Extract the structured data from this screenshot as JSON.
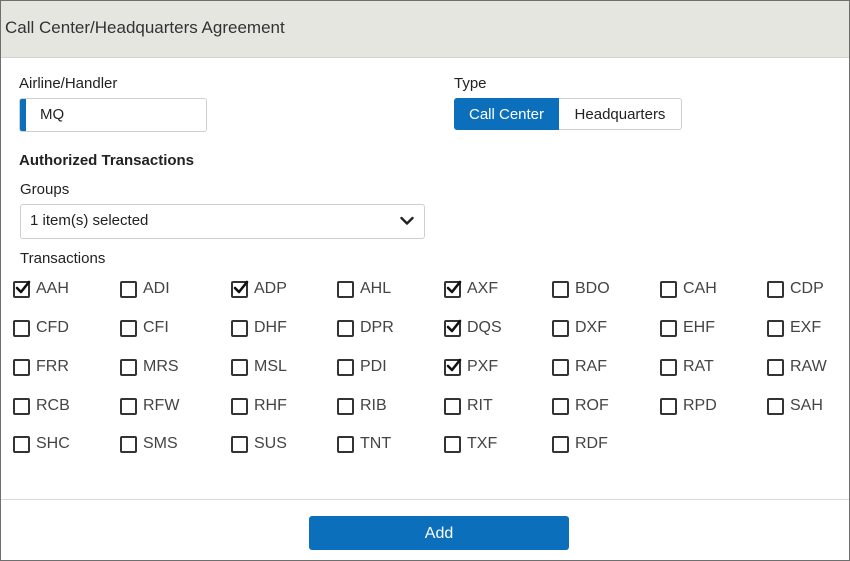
{
  "header": {
    "title": "Call Center/Headquarters Agreement"
  },
  "airline": {
    "label": "Airline/Handler",
    "value": "MQ"
  },
  "type": {
    "label": "Type",
    "options": [
      "Call Center",
      "Headquarters"
    ],
    "selected": "Call Center"
  },
  "authorized": {
    "heading": "Authorized Transactions"
  },
  "groups": {
    "label": "Groups",
    "value": "1 item(s) selected"
  },
  "transactions": {
    "label": "Transactions",
    "items": [
      {
        "code": "AAH",
        "checked": true
      },
      {
        "code": "ADI",
        "checked": false
      },
      {
        "code": "ADP",
        "checked": true
      },
      {
        "code": "AHL",
        "checked": false
      },
      {
        "code": "AXF",
        "checked": true
      },
      {
        "code": "BDO",
        "checked": false
      },
      {
        "code": "CAH",
        "checked": false
      },
      {
        "code": "CDP",
        "checked": false
      },
      {
        "code": "CFD",
        "checked": false
      },
      {
        "code": "CFI",
        "checked": false
      },
      {
        "code": "DHF",
        "checked": false
      },
      {
        "code": "DPR",
        "checked": false
      },
      {
        "code": "DQS",
        "checked": true
      },
      {
        "code": "DXF",
        "checked": false
      },
      {
        "code": "EHF",
        "checked": false
      },
      {
        "code": "EXF",
        "checked": false
      },
      {
        "code": "FRR",
        "checked": false
      },
      {
        "code": "MRS",
        "checked": false
      },
      {
        "code": "MSL",
        "checked": false
      },
      {
        "code": "PDI",
        "checked": false
      },
      {
        "code": "PXF",
        "checked": true
      },
      {
        "code": "RAF",
        "checked": false
      },
      {
        "code": "RAT",
        "checked": false
      },
      {
        "code": "RAW",
        "checked": false
      },
      {
        "code": "RCB",
        "checked": false
      },
      {
        "code": "RFW",
        "checked": false
      },
      {
        "code": "RHF",
        "checked": false
      },
      {
        "code": "RIB",
        "checked": false
      },
      {
        "code": "RIT",
        "checked": false
      },
      {
        "code": "ROF",
        "checked": false
      },
      {
        "code": "RPD",
        "checked": false
      },
      {
        "code": "SAH",
        "checked": false
      },
      {
        "code": "SHC",
        "checked": false
      },
      {
        "code": "SMS",
        "checked": false
      },
      {
        "code": "SUS",
        "checked": false
      },
      {
        "code": "TNT",
        "checked": false
      },
      {
        "code": "TXF",
        "checked": false
      },
      {
        "code": "RDF",
        "checked": false
      }
    ]
  },
  "actions": {
    "add_label": "Add"
  },
  "colors": {
    "accent": "#0b6fbc",
    "header_bg": "#e6e6e1"
  },
  "icons": {
    "dropdown": "chevron-down-icon",
    "check": "checkmark-icon"
  }
}
